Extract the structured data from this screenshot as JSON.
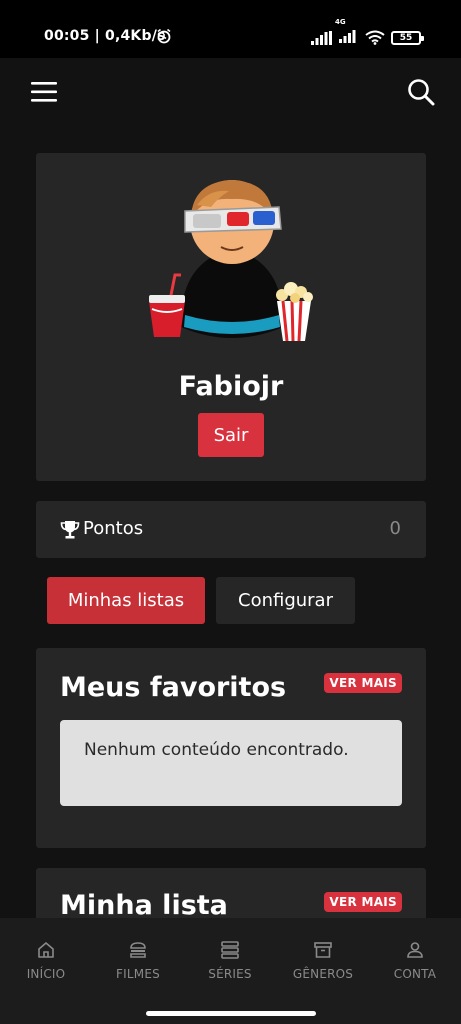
{
  "status_bar": {
    "time_speed": "00:05 | 0,4Kb/s",
    "network": "4G",
    "battery": "55"
  },
  "header": {
    "menu_icon": "hamburger-menu-icon",
    "search_icon": "search-icon"
  },
  "profile": {
    "username": "Fabiojr",
    "logout_label": "Sair",
    "avatar_icon": "movie-fan-avatar"
  },
  "points": {
    "label": "Pontos",
    "value": "0",
    "icon": "trophy-icon"
  },
  "tabs": [
    {
      "label": "Minhas listas",
      "active": true
    },
    {
      "label": "Configurar",
      "active": false
    }
  ],
  "favorites": {
    "title": "Meus favoritos",
    "see_more": "VER MAIS",
    "empty_text": "Nenhum conteúdo encontrado."
  },
  "my_list": {
    "title": "Minha lista",
    "see_more": "VER MAIS"
  },
  "bottom_nav": [
    {
      "label": "INÍCIO",
      "icon": "home-icon"
    },
    {
      "label": "FILMES",
      "icon": "film-icon"
    },
    {
      "label": "SÉRIES",
      "icon": "series-icon"
    },
    {
      "label": "GÊNEROS",
      "icon": "archive-icon"
    },
    {
      "label": "CONTA",
      "icon": "user-icon"
    }
  ],
  "colors": {
    "accent": "#d9323f",
    "background": "#121212",
    "card": "#262626",
    "muted": "#8a8a8a"
  }
}
